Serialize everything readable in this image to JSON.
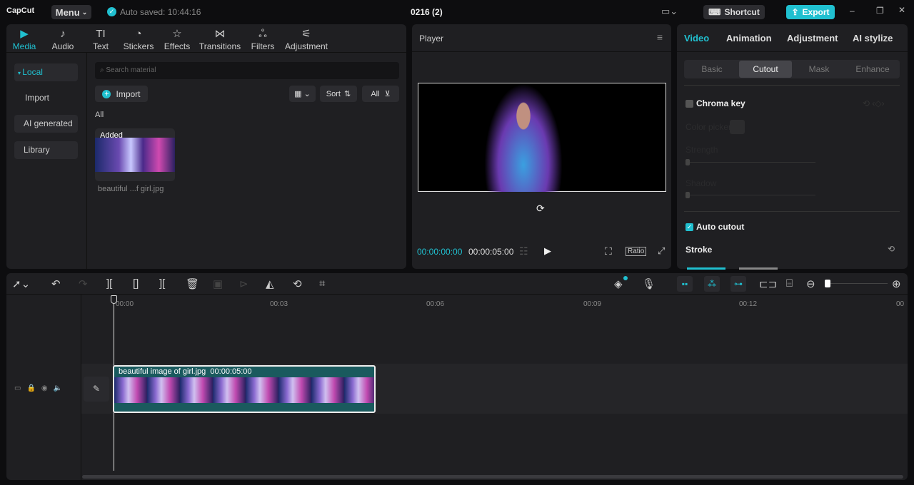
{
  "app": {
    "logo": "CapCut",
    "menu": "Menu",
    "autosave": "Auto saved: 10:44:16",
    "project": "0216 (2)",
    "shortcut": "Shortcut",
    "export": "Export"
  },
  "tabs": [
    {
      "label": "Media",
      "icon": "media-icon"
    },
    {
      "label": "Audio",
      "icon": "audio-icon"
    },
    {
      "label": "Text",
      "icon": "text-icon"
    },
    {
      "label": "Stickers",
      "icon": "stickers-icon"
    },
    {
      "label": "Effects",
      "icon": "effects-icon"
    },
    {
      "label": "Transitions",
      "icon": "transitions-icon"
    },
    {
      "label": "Filters",
      "icon": "filters-icon"
    },
    {
      "label": "Adjustment",
      "icon": "adjustment-icon"
    }
  ],
  "sidebar": [
    "Local",
    "Import",
    "AI generated",
    "Library"
  ],
  "media": {
    "search_placeholder": "Search material",
    "import": "Import",
    "sort": "Sort",
    "filter": "All",
    "section": "All",
    "badge": "Added",
    "filename": "beautiful ...f girl.jpg"
  },
  "player": {
    "title": "Player",
    "current": "00:00:00:00",
    "total": "00:00:05:00",
    "ratio": "Ratio"
  },
  "right": {
    "tabs": [
      "Video",
      "Animation",
      "Adjustment",
      "AI stylize"
    ],
    "subtabs": [
      "Basic",
      "Cutout",
      "Mask",
      "Enhance"
    ],
    "chroma": "Chroma key",
    "color_picker": "Color picker",
    "strength": "Strength",
    "shadow": "Shadow",
    "auto_cutout": "Auto cutout",
    "stroke": "Stroke"
  },
  "timeline": {
    "ticks": [
      "00:00",
      "00:03",
      "00:06",
      "00:09",
      "00:12",
      "00"
    ],
    "clip_name": "beautiful image of girl.jpg",
    "clip_duration": "00:00:05:00"
  },
  "colors": {
    "accent": "#20c0d0",
    "clip": "#1a5a5e"
  }
}
